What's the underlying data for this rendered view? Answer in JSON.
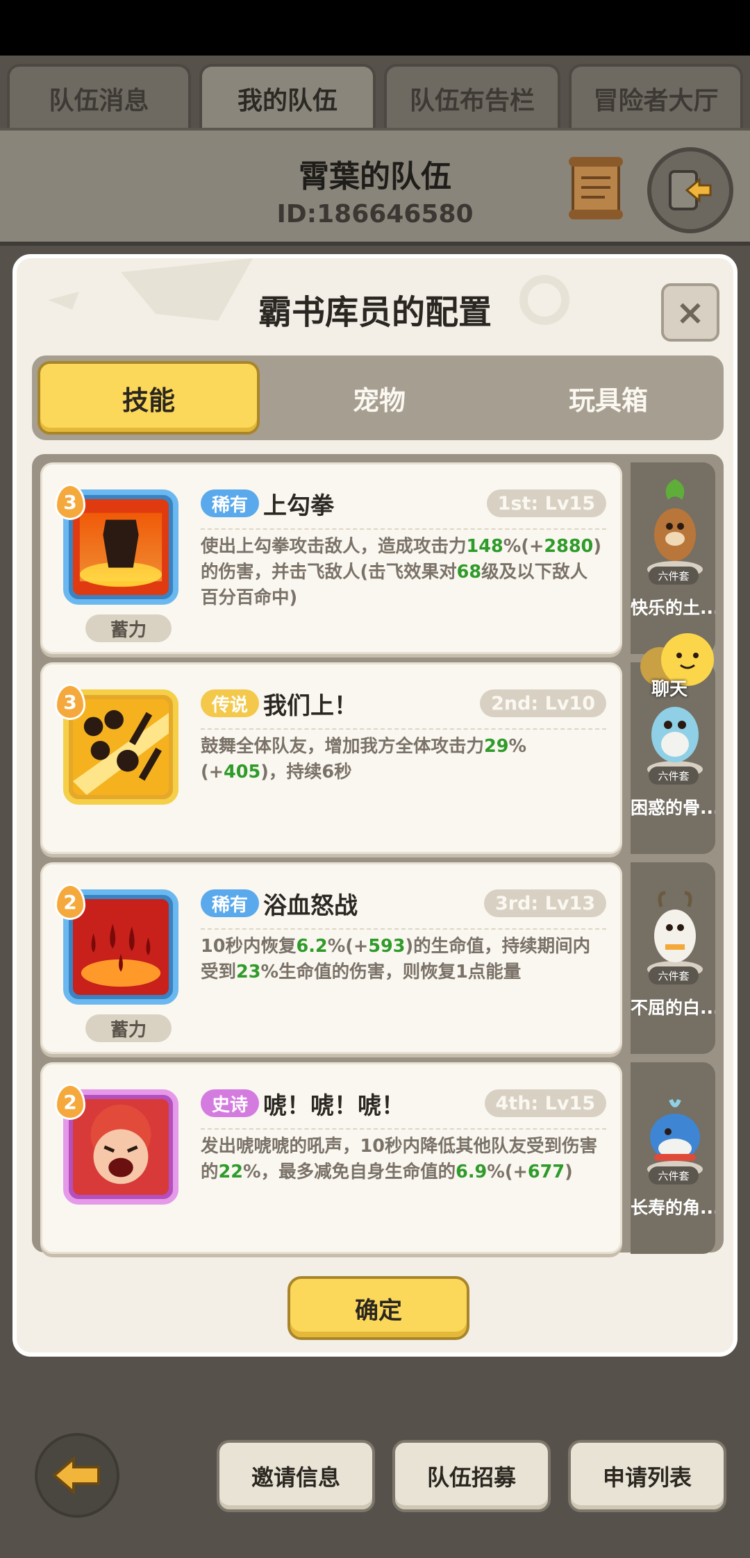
{
  "top_tabs": [
    {
      "label": "队伍消息"
    },
    {
      "label": "我的队伍"
    },
    {
      "label": "队伍布告栏"
    },
    {
      "label": "冒险者大厅"
    }
  ],
  "team": {
    "name": "霄葉的队伍",
    "id": "ID:186646580"
  },
  "modal": {
    "title": "霸书库员的配置",
    "close_label": "×",
    "tabs": [
      {
        "label": "技能"
      },
      {
        "label": "宠物"
      },
      {
        "label": "玩具箱"
      }
    ],
    "skills": [
      {
        "badge": "3",
        "rarity": "稀有",
        "name": "上勾拳",
        "level": "1st: Lv15",
        "tag": "蓄力",
        "desc": [
          "使出上勾拳攻击敌人，造成攻击力",
          "148",
          "%(+",
          "2880",
          ")的伤害，并击飞敌人(击飞效果对",
          "68",
          "级及以下敌人百分百命中)"
        ]
      },
      {
        "badge": "3",
        "rarity": "传说",
        "name": "我们上！",
        "level": "2nd: Lv10",
        "tag": "",
        "desc": [
          "鼓舞全体队友，增加我方全体攻击力",
          "29",
          "%(+",
          "405",
          ")，持续6秒"
        ]
      },
      {
        "badge": "2",
        "rarity": "稀有",
        "name": "浴血怒战",
        "level": "3rd: Lv13",
        "tag": "蓄力",
        "desc": [
          "10秒内恢复",
          "6.2",
          "%(+",
          "593",
          ")的生命值，持续期间内受到",
          "23",
          "%生命值的伤害，则恢复1点能量"
        ]
      },
      {
        "badge": "2",
        "rarity": "史诗",
        "name": "唬！唬！唬！",
        "level": "4th: Lv15",
        "tag": "",
        "desc": [
          "发出唬唬唬的吼声，10秒内降低其他队友受到伤害的",
          "22",
          "%，最多减免自身生命值的",
          "6.9",
          "%(+",
          "677",
          ")"
        ]
      }
    ],
    "pets": [
      {
        "set_tag": "六件套",
        "name": "快乐的土..."
      },
      {
        "set_tag": "六件套",
        "name": "困惑的骨..."
      },
      {
        "set_tag": "六件套",
        "name": "不屈的白..."
      },
      {
        "set_tag": "六件套",
        "name": "长寿的角..."
      }
    ],
    "confirm_label": "确定"
  },
  "chat": {
    "label": "聊天"
  },
  "bottom_buttons": [
    {
      "label": "邀请信息"
    },
    {
      "label": "队伍招募"
    },
    {
      "label": "申请列表"
    }
  ],
  "colors": {
    "accent_yellow": "#fbd85a",
    "highlight_green": "#2e9b2a",
    "rare": "#5aa9ec",
    "legend": "#f4c84a",
    "epic": "#d47be0"
  }
}
